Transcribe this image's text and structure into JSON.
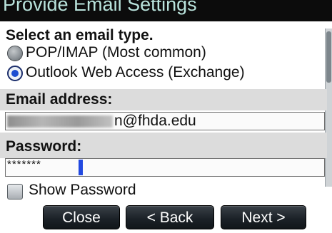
{
  "window": {
    "title": "Provide Email Settings"
  },
  "email_type": {
    "prompt": "Select an email type.",
    "options": [
      {
        "label": "POP/IMAP (Most common)",
        "selected": false
      },
      {
        "label": "Outlook Web Access (Exchange)",
        "selected": true
      }
    ]
  },
  "email_address": {
    "label": "Email address:",
    "visible_value": "n@fhda.edu"
  },
  "password": {
    "label": "Password:",
    "masked_value": "*******"
  },
  "show_password": {
    "label": "Show Password",
    "checked": false
  },
  "buttons": {
    "close": "Close",
    "back": "< Back",
    "next": "Next >"
  },
  "colors": {
    "accent": "#1d4fd1",
    "title_text": "#b9e3dc",
    "button_bg": "#1c2228"
  }
}
